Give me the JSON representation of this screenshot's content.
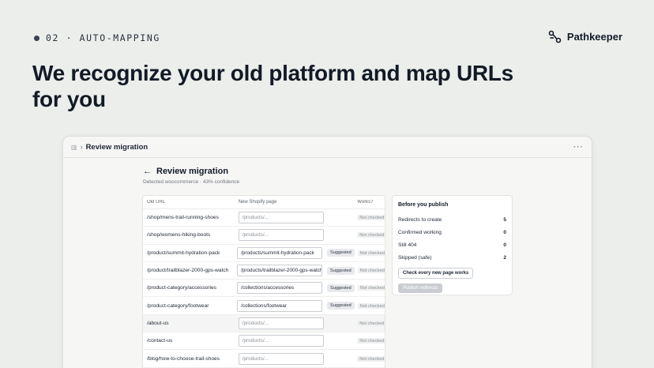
{
  "eyebrow": {
    "label": "02 · AUTO-MAPPING"
  },
  "brand": {
    "name": "Pathkeeper",
    "icon": "pathkeeper-logo-icon"
  },
  "headline": "We recognize your old platform and map URLs for you",
  "window": {
    "breadcrumb": "Review migration",
    "more": "···"
  },
  "page": {
    "title": "Review migration",
    "subtitle": "Detected woocommerce · 43% confidence"
  },
  "table": {
    "headers": {
      "old": "Old URL",
      "new": "New Shopify page",
      "works": "Works?"
    },
    "rows": [
      {
        "old": "/shop/mens-trail-running-shoes",
        "new": "",
        "placeholder": "/products/...",
        "badge": "",
        "works": "Not checked"
      },
      {
        "old": "/shop/womens-hiking-boots",
        "new": "",
        "placeholder": "/products/...",
        "badge": "",
        "works": "Not checked"
      },
      {
        "old": "/product/summit-hydration-pack",
        "new": "/products/summit-hydration-pack",
        "placeholder": "",
        "badge": "Suggested",
        "works": "Not checked"
      },
      {
        "old": "/product/trailblazer-2000-gps-watch",
        "new": "/products/trailblazer-2000-gps-watch",
        "placeholder": "",
        "badge": "Suggested",
        "works": "Not checked"
      },
      {
        "old": "/product-category/accessories",
        "new": "/collections/accessories",
        "placeholder": "",
        "badge": "Suggested",
        "works": "Not checked"
      },
      {
        "old": "/product-category/footwear",
        "new": "/collections/footwear",
        "placeholder": "",
        "badge": "Suggested",
        "works": "Not checked"
      },
      {
        "old": "/about-us",
        "new": "",
        "placeholder": "/products/...",
        "badge": "",
        "works": "Not checked"
      },
      {
        "old": "/contact-us",
        "new": "",
        "placeholder": "/products/...",
        "badge": "",
        "works": "Not checked"
      },
      {
        "old": "/blog/how-to-choose-trail-shoes",
        "new": "",
        "placeholder": "/products/...",
        "badge": "",
        "works": "Not checked"
      }
    ]
  },
  "summary": {
    "title": "Before you publish",
    "items": [
      {
        "label": "Redirects to create",
        "value": "5"
      },
      {
        "label": "Confirmed working",
        "value": "0"
      },
      {
        "label": "Still 404",
        "value": "0"
      },
      {
        "label": "Skipped (safe)",
        "value": "2"
      }
    ],
    "check_button": "Check every new page works",
    "publish_button": "Publish redirects"
  }
}
